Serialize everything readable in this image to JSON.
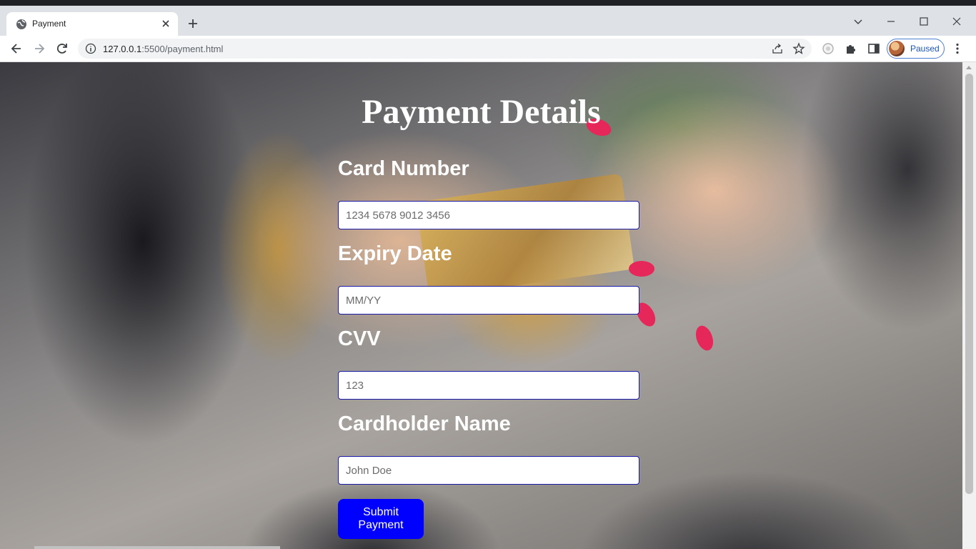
{
  "browser": {
    "tab_title": "Payment",
    "url_host": "127.0.0.1",
    "url_rest": ":5500/payment.html",
    "profile_label": "Paused",
    "icons": [
      "globe-icon",
      "close-icon",
      "plus-icon",
      "chevron-down-icon",
      "minimize-icon",
      "maximize-icon",
      "window-close-icon",
      "back-icon",
      "forward-icon",
      "reload-icon",
      "info-icon",
      "share-icon",
      "star-icon",
      "extension-icon",
      "puzzle-icon",
      "sidebar-icon",
      "menu-icon"
    ]
  },
  "page": {
    "title": "Payment Details",
    "fields": [
      {
        "label": "Card Number",
        "placeholder": "1234 5678 9012 3456"
      },
      {
        "label": "Expiry Date",
        "placeholder": "MM/YY"
      },
      {
        "label": "CVV",
        "placeholder": "123"
      },
      {
        "label": "Cardholder Name",
        "placeholder": "John Doe"
      }
    ],
    "submit_label": "Submit Payment",
    "submit_color": "#0000ff",
    "input_border_color": "#1a1aa8"
  }
}
